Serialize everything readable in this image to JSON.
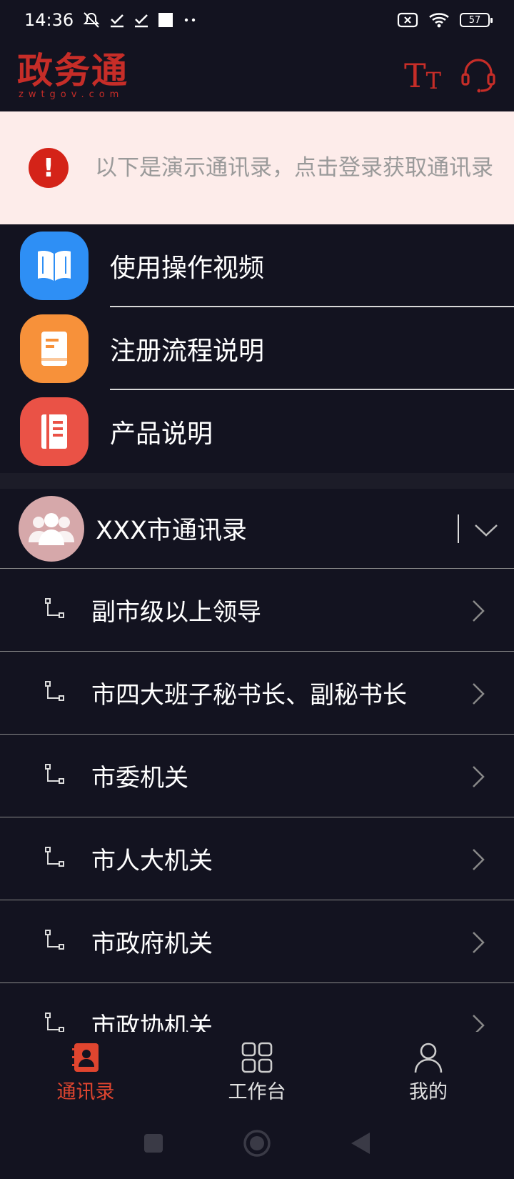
{
  "status_bar": {
    "time": "14:36",
    "battery": "57"
  },
  "header": {
    "logo_main": "政务通",
    "logo_sub": "zwtgov.com",
    "font_size_big": "T",
    "font_size_small": "T"
  },
  "banner": {
    "icon_text": "!",
    "message": "以下是演示通讯录，点击登录获取通讯录"
  },
  "help_items": [
    {
      "label": "使用操作视频",
      "color": "#2e8ff5",
      "icon": "book-icon"
    },
    {
      "label": "注册流程说明",
      "color": "#f7913a",
      "icon": "document-icon"
    },
    {
      "label": "产品说明",
      "color": "#ea5246",
      "icon": "notebook-icon"
    }
  ],
  "directory": {
    "title": "XXX市通讯录",
    "avatar_color": "#d6a8aa"
  },
  "departments": [
    {
      "label": "副市级以上领导"
    },
    {
      "label": "市四大班子秘书长、副秘书长"
    },
    {
      "label": "市委机关"
    },
    {
      "label": "市人大机关"
    },
    {
      "label": "市政府机关"
    },
    {
      "label": "市政协机关"
    }
  ],
  "bottom_nav": [
    {
      "label": "通讯录",
      "active": true
    },
    {
      "label": "工作台",
      "active": false
    },
    {
      "label": "我的",
      "active": false
    }
  ],
  "colors": {
    "accent": "#e0452f",
    "brand_red": "#c62d28",
    "banner_bg": "#fdecea",
    "background": "#131320"
  }
}
